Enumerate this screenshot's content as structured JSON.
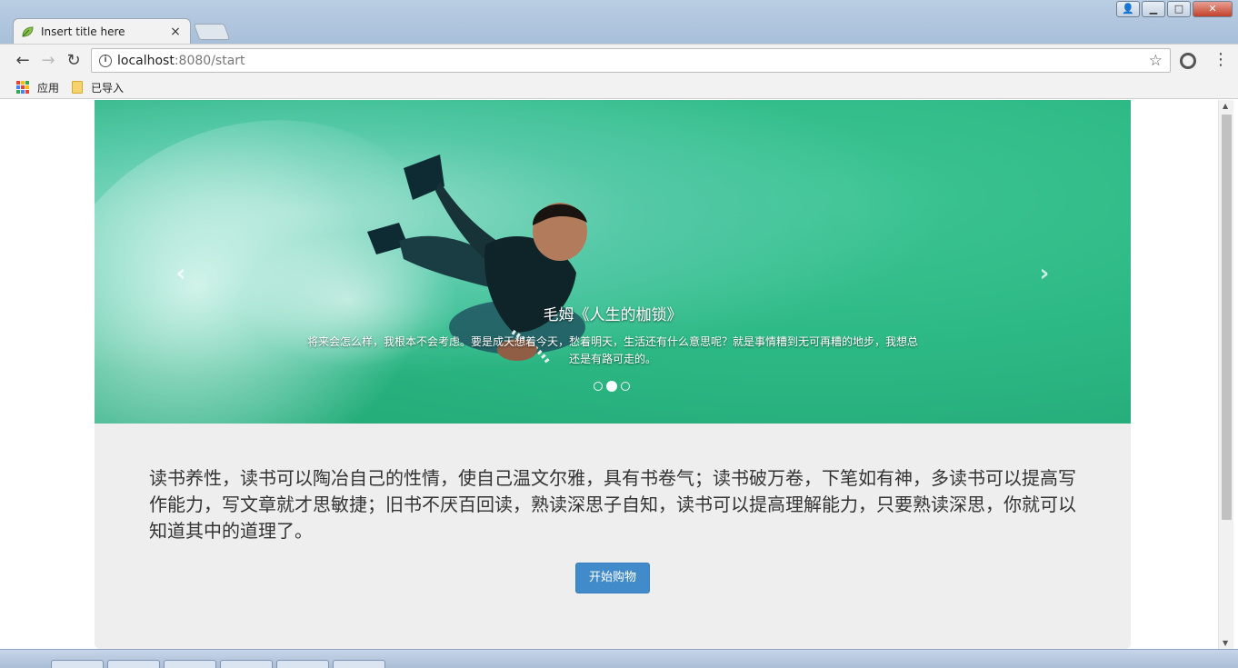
{
  "browser": {
    "tab_title": "Insert title here",
    "tab_close": "×",
    "address_host": "localhost",
    "address_path": ":8080/start",
    "bookmarks": [
      {
        "label": "应用",
        "icon": "apps-grid-icon"
      },
      {
        "label": "已导入",
        "icon": "folder-icon"
      }
    ],
    "window_buttons": {
      "minimize": "▁",
      "maximize": "□",
      "close": "✕"
    }
  },
  "carousel": {
    "caption_title": "毛姆《人生的枷锁》",
    "caption_text": "将来会怎么样，我根本不会考虑。要是成天想着今天，愁着明天，生活还有什么意思呢？就是事情糟到无可再糟的地步，我想总还是有路可走的。",
    "prev_label": "‹",
    "next_label": "›",
    "slide_count": 3,
    "active_index": 1
  },
  "jumbotron": {
    "lead": "读书养性，读书可以陶冶自己的性情，使自己温文尔雅，具有书卷气；读书破万卷，下笔如有神，多读书可以提高写作能力，写文章就才思敏捷；旧书不厌百回读，熟读深思子自知，读书可以提高理解能力，只要熟读深思，你就可以知道其中的道理了。",
    "button_label": "开始购物"
  },
  "colors": {
    "primary_button": "#428bca",
    "jumbotron_bg": "#eeeeee",
    "sea": "#2db985"
  }
}
